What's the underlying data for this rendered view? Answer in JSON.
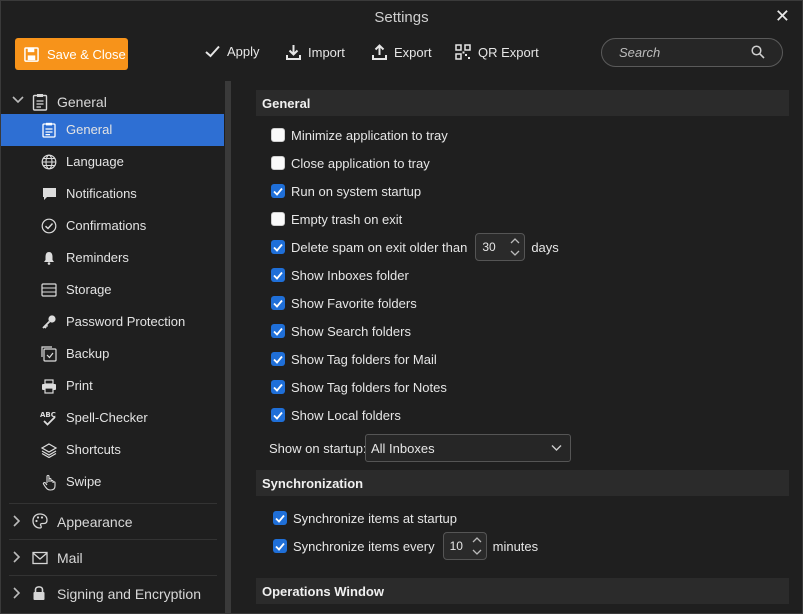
{
  "window": {
    "title": "Settings"
  },
  "toolbar": {
    "save_close": "Save & Close",
    "apply": "Apply",
    "import": "Import",
    "export": "Export",
    "qr_export": "QR Export",
    "search_placeholder": "Search"
  },
  "sidebar": {
    "general_group": "General",
    "items": [
      {
        "label": "General",
        "icon": "clipboard-icon"
      },
      {
        "label": "Language",
        "icon": "globe-icon"
      },
      {
        "label": "Notifications",
        "icon": "chat-bubble-icon"
      },
      {
        "label": "Confirmations",
        "icon": "check-circle-icon"
      },
      {
        "label": "Reminders",
        "icon": "bell-icon"
      },
      {
        "label": "Storage",
        "icon": "storage-icon"
      },
      {
        "label": "Password Protection",
        "icon": "key-icon"
      },
      {
        "label": "Backup",
        "icon": "backup-icon"
      },
      {
        "label": "Print",
        "icon": "printer-icon"
      },
      {
        "label": "Spell-Checker",
        "icon": "spellcheck-icon"
      },
      {
        "label": "Shortcuts",
        "icon": "layers-icon"
      },
      {
        "label": "Swipe",
        "icon": "hand-icon"
      }
    ],
    "appearance_group": "Appearance",
    "mail_group": "Mail",
    "signing_group": "Signing and Encryption"
  },
  "general_section": {
    "header": "General",
    "minimize_tray": "Minimize application to tray",
    "close_tray": "Close application to tray",
    "run_startup": "Run on system startup",
    "empty_trash": "Empty trash on exit",
    "delete_spam": "Delete spam on exit older than",
    "delete_spam_value": "30",
    "delete_spam_unit": "days",
    "show_inboxes": "Show Inboxes folder",
    "show_favorite": "Show Favorite folders",
    "show_search": "Show Search folders",
    "show_tag_mail": "Show Tag folders for Mail",
    "show_tag_notes": "Show Tag folders for Notes",
    "show_local": "Show Local folders",
    "show_on_startup_label": "Show on startup:",
    "show_on_startup_value": "All Inboxes",
    "checks": {
      "minimize_tray": false,
      "close_tray": false,
      "run_startup": true,
      "empty_trash": false,
      "delete_spam": true,
      "show_inboxes": true,
      "show_favorite": true,
      "show_search": true,
      "show_tag_mail": true,
      "show_tag_notes": true,
      "show_local": true
    }
  },
  "sync_section": {
    "header": "Synchronization",
    "sync_startup": "Synchronize items at startup",
    "sync_every": "Synchronize items every",
    "sync_every_value": "10",
    "sync_every_unit": "minutes",
    "checks": {
      "sync_startup": true,
      "sync_every": true
    }
  },
  "ops_section": {
    "header": "Operations Window"
  },
  "colors": {
    "accent": "#f7931a",
    "selection": "#2e6fd3",
    "checkbox": "#1f6fd8"
  }
}
